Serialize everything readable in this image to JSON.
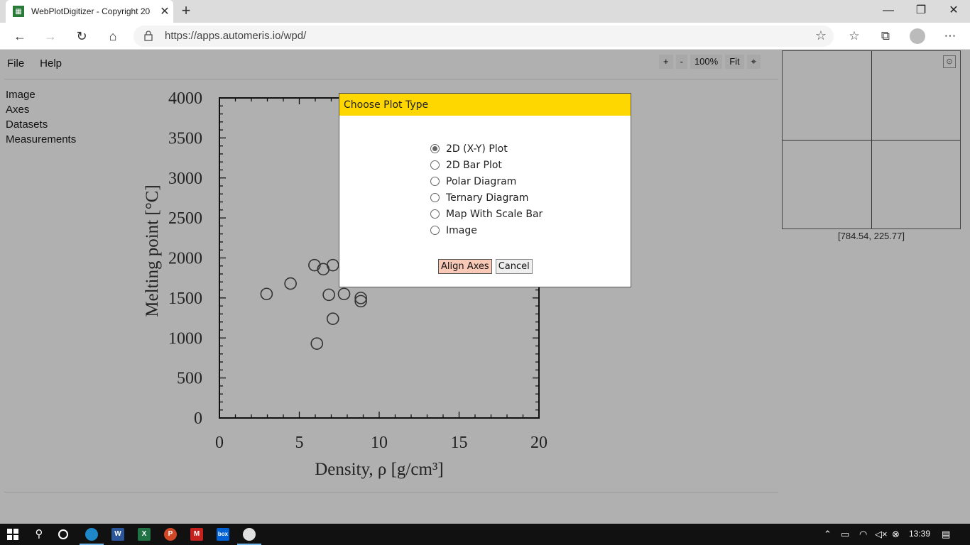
{
  "browser": {
    "tab_title": "WebPlotDigitizer - Copyright 20",
    "tab_close": "✕",
    "new_tab": "+",
    "url": "https://apps.automeris.io/wpd/",
    "window_controls": [
      "—",
      "❐",
      "✕"
    ]
  },
  "app": {
    "menu": [
      "File",
      "Help"
    ],
    "sidebar": [
      "Image",
      "Axes",
      "Datasets",
      "Measurements"
    ],
    "zoom": {
      "plus": "+",
      "minus": "-",
      "level": "100%",
      "fit": "Fit"
    },
    "cursor_coords": "[784.54, 225.77]"
  },
  "dialog": {
    "title": "Choose Plot Type",
    "options": [
      {
        "label": "2D (X-Y) Plot",
        "checked": true
      },
      {
        "label": "2D Bar Plot",
        "checked": false
      },
      {
        "label": "Polar Diagram",
        "checked": false
      },
      {
        "label": "Ternary Diagram",
        "checked": false
      },
      {
        "label": "Map With Scale Bar",
        "checked": false
      },
      {
        "label": "Image",
        "checked": false
      }
    ],
    "align_label": "Align Axes",
    "cancel_label": "Cancel"
  },
  "chart_data": {
    "type": "scatter",
    "xlabel": "Density, ρ [g/cm³]",
    "ylabel": "Melting point [°C]",
    "xlim": [
      0,
      20
    ],
    "ylim": [
      0,
      4000
    ],
    "xticks": [
      "0",
      "5",
      "10",
      "15",
      "20"
    ],
    "yticks": [
      "0",
      "500",
      "1000",
      "1500",
      "2000",
      "2500",
      "3000",
      "3500",
      "4000"
    ],
    "grid": false,
    "points": [
      {
        "x": 2.95,
        "y": 1550
      },
      {
        "x": 4.45,
        "y": 1680
      },
      {
        "x": 5.95,
        "y": 1910
      },
      {
        "x": 6.5,
        "y": 1860
      },
      {
        "x": 7.1,
        "y": 1910
      },
      {
        "x": 6.85,
        "y": 1540
      },
      {
        "x": 7.8,
        "y": 1550
      },
      {
        "x": 8.85,
        "y": 1500
      },
      {
        "x": 8.85,
        "y": 1460
      },
      {
        "x": 7.1,
        "y": 1240
      },
      {
        "x": 6.1,
        "y": 930
      }
    ]
  },
  "taskbar": {
    "apps": [
      "W",
      "X",
      "P",
      "M",
      "box"
    ],
    "time": "13:39"
  }
}
